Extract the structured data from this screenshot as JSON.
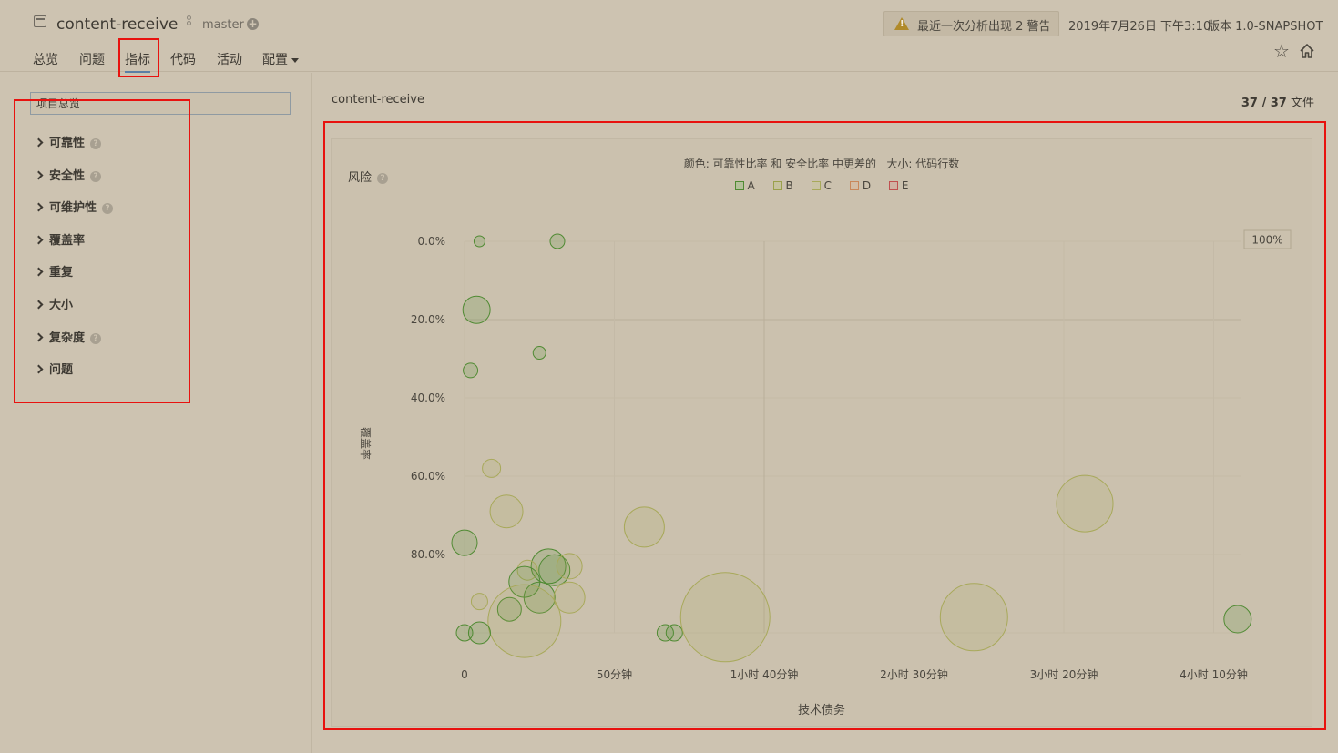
{
  "header": {
    "project_name": "content-receive",
    "branch": "master",
    "warning": "最近一次分析出现 2 警告",
    "date": "2019年7月26日 下午3:10",
    "version": "版本 1.0-SNAPSHOT",
    "nav": [
      {
        "label": "总览"
      },
      {
        "label": "问题"
      },
      {
        "label": "指标"
      },
      {
        "label": "代码"
      },
      {
        "label": "活动"
      },
      {
        "label": "配置"
      }
    ]
  },
  "sidebar": {
    "search_value": "项目总览",
    "items": [
      {
        "label": "可靠性",
        "help": true
      },
      {
        "label": "安全性",
        "help": true
      },
      {
        "label": "可维护性",
        "help": true
      },
      {
        "label": "覆盖率",
        "help": false
      },
      {
        "label": "重复",
        "help": false
      },
      {
        "label": "大小",
        "help": false
      },
      {
        "label": "复杂度",
        "help": true
      },
      {
        "label": "问题",
        "help": false
      }
    ]
  },
  "main": {
    "breadcrumb": "content-receive",
    "files_count": "37 / 37",
    "files_label": "文件",
    "panel_title": "风险",
    "legend_title": "颜色: 可靠性比率 和 安全比率 中更差的   大小: 代码行数",
    "zoom": "100%"
  },
  "colors": {
    "A": "#4f8a32",
    "B": "#9aa04b",
    "C": "#a8a95a",
    "D": "#c9885a",
    "E": "#c05050",
    "highlight": "#e8120f"
  },
  "chart_data": {
    "type": "scatter",
    "title": "",
    "xlabel": "技术债务",
    "ylabel": "覆盖率",
    "x_unit": "minutes",
    "xlim": [
      0,
      260
    ],
    "ylim": [
      0,
      100
    ],
    "y_reversed": true,
    "x_ticks": [
      {
        "value": 0,
        "label": "0"
      },
      {
        "value": 50,
        "label": "50分钟"
      },
      {
        "value": 100,
        "label": "1小时 40分钟"
      },
      {
        "value": 150,
        "label": "2小时 30分钟"
      },
      {
        "value": 200,
        "label": "3小时 20分钟"
      },
      {
        "value": 250,
        "label": "4小时 10分钟"
      }
    ],
    "y_ticks": [
      {
        "value": 0,
        "label": "0.0%"
      },
      {
        "value": 20,
        "label": "20.0%"
      },
      {
        "value": 40,
        "label": "40.0%"
      },
      {
        "value": 60,
        "label": "60.0%"
      },
      {
        "value": 80,
        "label": "80.0%"
      }
    ],
    "legend": [
      "A",
      "B",
      "C",
      "D",
      "E"
    ],
    "points": [
      {
        "x": 5,
        "y": 0,
        "size": 6,
        "rating": "A"
      },
      {
        "x": 31,
        "y": 0,
        "size": 8,
        "rating": "A"
      },
      {
        "x": 4,
        "y": 17.5,
        "size": 15,
        "rating": "A"
      },
      {
        "x": 25,
        "y": 28.5,
        "size": 7,
        "rating": "A"
      },
      {
        "x": 2,
        "y": 33,
        "size": 8,
        "rating": "A"
      },
      {
        "x": 9,
        "y": 58,
        "size": 10,
        "rating": "C"
      },
      {
        "x": 14,
        "y": 69,
        "size": 18,
        "rating": "C"
      },
      {
        "x": 0,
        "y": 77,
        "size": 14,
        "rating": "A"
      },
      {
        "x": 60,
        "y": 73,
        "size": 22,
        "rating": "C"
      },
      {
        "x": 207,
        "y": 67,
        "size": 31,
        "rating": "C"
      },
      {
        "x": 28,
        "y": 83,
        "size": 19,
        "rating": "A"
      },
      {
        "x": 30,
        "y": 84,
        "size": 17,
        "rating": "A"
      },
      {
        "x": 35,
        "y": 83,
        "size": 14,
        "rating": "C"
      },
      {
        "x": 21,
        "y": 84,
        "size": 11,
        "rating": "C"
      },
      {
        "x": 20,
        "y": 87,
        "size": 17,
        "rating": "A"
      },
      {
        "x": 25,
        "y": 91,
        "size": 17,
        "rating": "A"
      },
      {
        "x": 35,
        "y": 91,
        "size": 17,
        "rating": "C"
      },
      {
        "x": 5,
        "y": 92,
        "size": 9,
        "rating": "C"
      },
      {
        "x": 15,
        "y": 94,
        "size": 13,
        "rating": "A"
      },
      {
        "x": 20,
        "y": 97,
        "size": 40,
        "rating": "C"
      },
      {
        "x": 0,
        "y": 100,
        "size": 9,
        "rating": "A"
      },
      {
        "x": 5,
        "y": 100,
        "size": 12,
        "rating": "A"
      },
      {
        "x": 67,
        "y": 100,
        "size": 9,
        "rating": "A"
      },
      {
        "x": 70,
        "y": 100,
        "size": 9,
        "rating": "A"
      },
      {
        "x": 87,
        "y": 96,
        "size": 49,
        "rating": "C"
      },
      {
        "x": 170,
        "y": 96,
        "size": 37,
        "rating": "C"
      },
      {
        "x": 258,
        "y": 96.5,
        "size": 15,
        "rating": "A"
      }
    ]
  }
}
